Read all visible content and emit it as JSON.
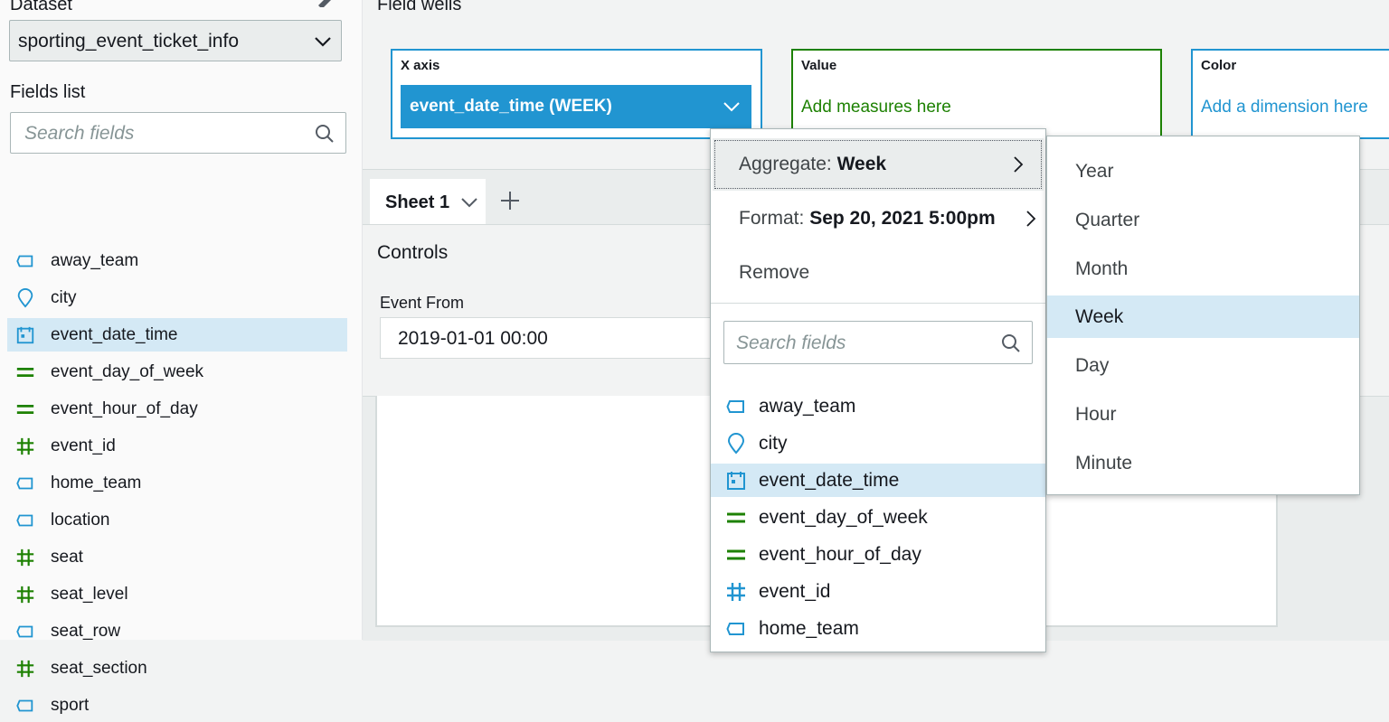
{
  "left_panel": {
    "dataset_label": "Dataset",
    "dataset_value": "sporting_event_ticket_info",
    "fields_list_label": "Fields list",
    "search_placeholder": "Search fields",
    "fields": [
      {
        "name": "away_team",
        "type": "string",
        "icon": "string-tag-icon"
      },
      {
        "name": "city",
        "type": "geo",
        "icon": "map-pin-icon"
      },
      {
        "name": "event_date_time",
        "type": "date",
        "icon": "calendar-icon",
        "selected": true
      },
      {
        "name": "event_day_of_week",
        "type": "integer-dimension",
        "icon": "equals-icon"
      },
      {
        "name": "event_hour_of_day",
        "type": "integer-dimension",
        "icon": "equals-icon"
      },
      {
        "name": "event_id",
        "type": "number",
        "icon": "hash-icon"
      },
      {
        "name": "home_team",
        "type": "string",
        "icon": "string-tag-icon"
      },
      {
        "name": "location",
        "type": "string",
        "icon": "string-tag-icon"
      },
      {
        "name": "seat",
        "type": "number-measure",
        "icon": "hash-icon"
      },
      {
        "name": "seat_level",
        "type": "number-measure",
        "icon": "hash-icon"
      },
      {
        "name": "seat_row",
        "type": "string",
        "icon": "string-tag-icon"
      },
      {
        "name": "seat_section",
        "type": "number-measure",
        "icon": "hash-icon"
      },
      {
        "name": "sport",
        "type": "string",
        "icon": "string-tag-icon"
      }
    ]
  },
  "field_wells": {
    "title": "Field wells",
    "x_axis": {
      "label": "X axis",
      "value": "event_date_time (WEEK)"
    },
    "value": {
      "label": "Value",
      "placeholder": "Add measures here"
    },
    "color": {
      "label": "Color",
      "placeholder": "Add a dimension here"
    }
  },
  "sheets": {
    "tabs": [
      "Sheet 1"
    ]
  },
  "controls": {
    "title": "Controls",
    "event_from_label": "Event From",
    "event_from_value": "2019-01-01 00:00"
  },
  "menu": {
    "aggregate_label": "Aggregate: ",
    "aggregate_value": "Week",
    "format_label": "Format: ",
    "format_value": "Sep 20, 2021 5:00pm",
    "remove_label": "Remove",
    "search_placeholder": "Search fields",
    "fields": [
      {
        "name": "away_team",
        "icon": "string-tag-icon"
      },
      {
        "name": "city",
        "icon": "map-pin-icon"
      },
      {
        "name": "event_date_time",
        "icon": "calendar-icon",
        "selected": true
      },
      {
        "name": "event_day_of_week",
        "icon": "equals-icon"
      },
      {
        "name": "event_hour_of_day",
        "icon": "equals-icon"
      },
      {
        "name": "event_id",
        "icon": "hash-icon"
      },
      {
        "name": "home_team",
        "icon": "string-tag-icon"
      }
    ]
  },
  "aggregate_submenu": {
    "options": [
      "Year",
      "Quarter",
      "Month",
      "Week",
      "Day",
      "Hour",
      "Minute"
    ],
    "selected": "Week"
  },
  "colors": {
    "accent_blue": "#2195d1",
    "dimension_blue": "#0073bb",
    "measure_green": "#1d8102",
    "selected_bg": "#d4e9f5"
  }
}
